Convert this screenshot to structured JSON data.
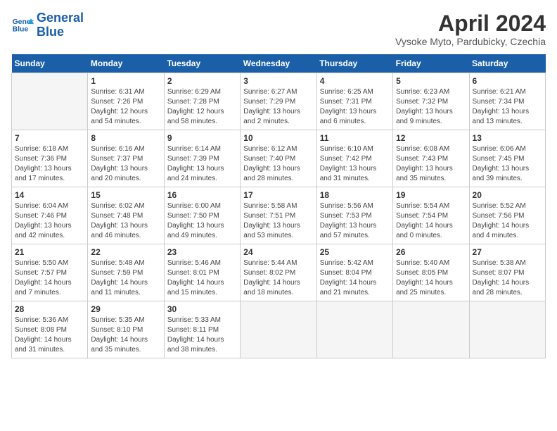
{
  "header": {
    "logo_line1": "General",
    "logo_line2": "Blue",
    "month_title": "April 2024",
    "subtitle": "Vysoke Myto, Pardubicky, Czechia"
  },
  "weekdays": [
    "Sunday",
    "Monday",
    "Tuesday",
    "Wednesday",
    "Thursday",
    "Friday",
    "Saturday"
  ],
  "weeks": [
    [
      {
        "day": "",
        "info": ""
      },
      {
        "day": "1",
        "info": "Sunrise: 6:31 AM\nSunset: 7:26 PM\nDaylight: 12 hours\nand 54 minutes."
      },
      {
        "day": "2",
        "info": "Sunrise: 6:29 AM\nSunset: 7:28 PM\nDaylight: 12 hours\nand 58 minutes."
      },
      {
        "day": "3",
        "info": "Sunrise: 6:27 AM\nSunset: 7:29 PM\nDaylight: 13 hours\nand 2 minutes."
      },
      {
        "day": "4",
        "info": "Sunrise: 6:25 AM\nSunset: 7:31 PM\nDaylight: 13 hours\nand 6 minutes."
      },
      {
        "day": "5",
        "info": "Sunrise: 6:23 AM\nSunset: 7:32 PM\nDaylight: 13 hours\nand 9 minutes."
      },
      {
        "day": "6",
        "info": "Sunrise: 6:21 AM\nSunset: 7:34 PM\nDaylight: 13 hours\nand 13 minutes."
      }
    ],
    [
      {
        "day": "7",
        "info": "Sunrise: 6:18 AM\nSunset: 7:36 PM\nDaylight: 13 hours\nand 17 minutes."
      },
      {
        "day": "8",
        "info": "Sunrise: 6:16 AM\nSunset: 7:37 PM\nDaylight: 13 hours\nand 20 minutes."
      },
      {
        "day": "9",
        "info": "Sunrise: 6:14 AM\nSunset: 7:39 PM\nDaylight: 13 hours\nand 24 minutes."
      },
      {
        "day": "10",
        "info": "Sunrise: 6:12 AM\nSunset: 7:40 PM\nDaylight: 13 hours\nand 28 minutes."
      },
      {
        "day": "11",
        "info": "Sunrise: 6:10 AM\nSunset: 7:42 PM\nDaylight: 13 hours\nand 31 minutes."
      },
      {
        "day": "12",
        "info": "Sunrise: 6:08 AM\nSunset: 7:43 PM\nDaylight: 13 hours\nand 35 minutes."
      },
      {
        "day": "13",
        "info": "Sunrise: 6:06 AM\nSunset: 7:45 PM\nDaylight: 13 hours\nand 39 minutes."
      }
    ],
    [
      {
        "day": "14",
        "info": "Sunrise: 6:04 AM\nSunset: 7:46 PM\nDaylight: 13 hours\nand 42 minutes."
      },
      {
        "day": "15",
        "info": "Sunrise: 6:02 AM\nSunset: 7:48 PM\nDaylight: 13 hours\nand 46 minutes."
      },
      {
        "day": "16",
        "info": "Sunrise: 6:00 AM\nSunset: 7:50 PM\nDaylight: 13 hours\nand 49 minutes."
      },
      {
        "day": "17",
        "info": "Sunrise: 5:58 AM\nSunset: 7:51 PM\nDaylight: 13 hours\nand 53 minutes."
      },
      {
        "day": "18",
        "info": "Sunrise: 5:56 AM\nSunset: 7:53 PM\nDaylight: 13 hours\nand 57 minutes."
      },
      {
        "day": "19",
        "info": "Sunrise: 5:54 AM\nSunset: 7:54 PM\nDaylight: 14 hours\nand 0 minutes."
      },
      {
        "day": "20",
        "info": "Sunrise: 5:52 AM\nSunset: 7:56 PM\nDaylight: 14 hours\nand 4 minutes."
      }
    ],
    [
      {
        "day": "21",
        "info": "Sunrise: 5:50 AM\nSunset: 7:57 PM\nDaylight: 14 hours\nand 7 minutes."
      },
      {
        "day": "22",
        "info": "Sunrise: 5:48 AM\nSunset: 7:59 PM\nDaylight: 14 hours\nand 11 minutes."
      },
      {
        "day": "23",
        "info": "Sunrise: 5:46 AM\nSunset: 8:01 PM\nDaylight: 14 hours\nand 15 minutes."
      },
      {
        "day": "24",
        "info": "Sunrise: 5:44 AM\nSunset: 8:02 PM\nDaylight: 14 hours\nand 18 minutes."
      },
      {
        "day": "25",
        "info": "Sunrise: 5:42 AM\nSunset: 8:04 PM\nDaylight: 14 hours\nand 21 minutes."
      },
      {
        "day": "26",
        "info": "Sunrise: 5:40 AM\nSunset: 8:05 PM\nDaylight: 14 hours\nand 25 minutes."
      },
      {
        "day": "27",
        "info": "Sunrise: 5:38 AM\nSunset: 8:07 PM\nDaylight: 14 hours\nand 28 minutes."
      }
    ],
    [
      {
        "day": "28",
        "info": "Sunrise: 5:36 AM\nSunset: 8:08 PM\nDaylight: 14 hours\nand 31 minutes."
      },
      {
        "day": "29",
        "info": "Sunrise: 5:35 AM\nSunset: 8:10 PM\nDaylight: 14 hours\nand 35 minutes."
      },
      {
        "day": "30",
        "info": "Sunrise: 5:33 AM\nSunset: 8:11 PM\nDaylight: 14 hours\nand 38 minutes."
      },
      {
        "day": "",
        "info": ""
      },
      {
        "day": "",
        "info": ""
      },
      {
        "day": "",
        "info": ""
      },
      {
        "day": "",
        "info": ""
      }
    ]
  ]
}
